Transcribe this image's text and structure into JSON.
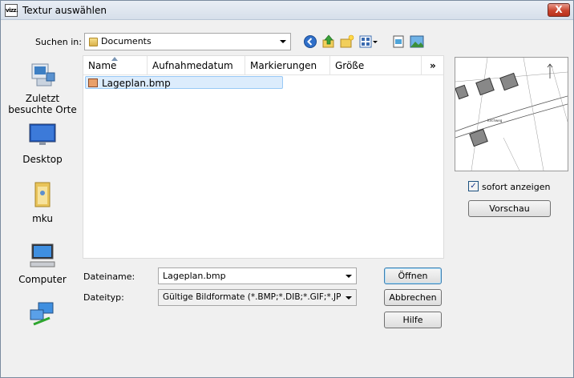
{
  "window": {
    "title": "Textur auswählen",
    "app_icon_text": "vizz.",
    "close_label": "X"
  },
  "lookin": {
    "label": "Suchen in:",
    "value": "Documents"
  },
  "toolbar": {
    "icons": [
      "back-icon",
      "up-folder-icon",
      "new-folder-icon",
      "view-menu-icon",
      "desktop-icon",
      "image-icon"
    ]
  },
  "places": [
    {
      "label": "Zuletzt besuchte Orte",
      "icon": "recent-places-icon"
    },
    {
      "label": "Desktop",
      "icon": "desktop-icon"
    },
    {
      "label": "mku",
      "icon": "user-folder-icon"
    },
    {
      "label": "Computer",
      "icon": "computer-icon"
    },
    {
      "label": "",
      "icon": "network-icon"
    }
  ],
  "filelist": {
    "columns": [
      "Name",
      "Aufnahmedatum",
      "Markierungen",
      "Größe"
    ],
    "more_columns": "»",
    "files": [
      {
        "name": "Lageplan.bmp",
        "icon": "bitmap-file-icon"
      }
    ]
  },
  "filename": {
    "label": "Dateiname:",
    "value": "Lageplan.bmp"
  },
  "filetype": {
    "label": "Dateityp:",
    "value": "Gültige Bildformate (*.BMP;*.DIB;*.GIF;*.JPG;*.J"
  },
  "buttons": {
    "open": "Öffnen",
    "cancel": "Abbrechen",
    "help": "Hilfe",
    "preview": "Vorschau"
  },
  "preview_panel": {
    "checkbox_label": "sofort anzeigen",
    "checked": true,
    "street_label": "Kirchweg"
  }
}
